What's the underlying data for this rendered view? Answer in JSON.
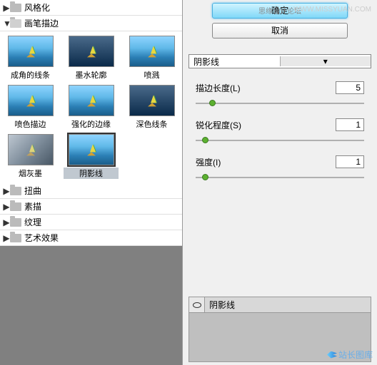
{
  "watermark_top": "WWW.MISSYUAN.COM",
  "watermark_bottom": "站长图库",
  "tree": {
    "items": [
      {
        "label": "风格化",
        "open": false
      },
      {
        "label": "画笔描边",
        "open": true
      },
      {
        "label": "扭曲",
        "open": false
      },
      {
        "label": "素描",
        "open": false
      },
      {
        "label": "纹理",
        "open": false
      },
      {
        "label": "艺术效果",
        "open": false
      }
    ]
  },
  "thumbs": [
    {
      "label": "成角的线条"
    },
    {
      "label": "墨水轮廓"
    },
    {
      "label": "喷溅"
    },
    {
      "label": "喷色描边"
    },
    {
      "label": "强化的边缘"
    },
    {
      "label": "深色线条"
    },
    {
      "label": "烟灰墨"
    },
    {
      "label": "阴影线",
      "selected": true
    }
  ],
  "buttons": {
    "ok": "确定",
    "cancel": "取消"
  },
  "filter_dropdown": {
    "value": "阴影线"
  },
  "params": [
    {
      "label": "描边长度(L)",
      "value": "5",
      "pos": 8
    },
    {
      "label": "锐化程度(S)",
      "value": "1",
      "pos": 4
    },
    {
      "label": "强度(I)",
      "value": "1",
      "pos": 4
    }
  ],
  "layer": {
    "name": "阴影线"
  },
  "overlay_text": "思缘设计论坛"
}
